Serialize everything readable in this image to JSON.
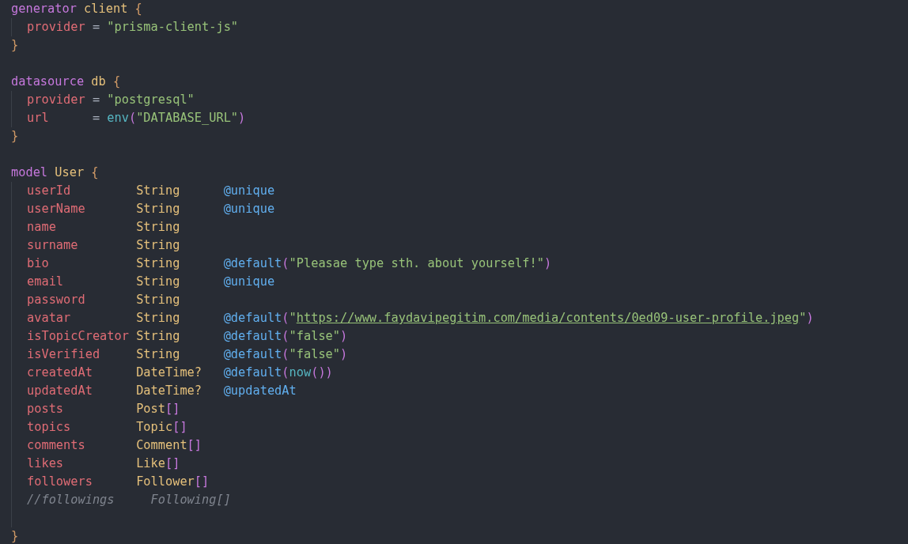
{
  "editor": {
    "blocks": [
      {
        "kind": "config",
        "head": [
          {
            "kind": "keyword",
            "text": "generator"
          },
          {
            "kind": "name",
            "text": "client"
          },
          {
            "kind": "brace",
            "text": "{"
          }
        ],
        "close": "}",
        "fields": [
          {
            "kind": "field",
            "cells": [
              [
                {
                  "kind": "property",
                  "text": "provider"
                }
              ],
              [
                {
                  "kind": "operator",
                  "text": "="
                }
              ],
              [
                {
                  "kind": "string",
                  "text": "\"prisma-client-js\""
                }
              ]
            ]
          }
        ]
      },
      {
        "kind": "config",
        "head": [
          {
            "kind": "keyword",
            "text": "datasource"
          },
          {
            "kind": "name",
            "text": "db"
          },
          {
            "kind": "brace",
            "text": "{"
          }
        ],
        "close": "}",
        "fields": [
          {
            "kind": "field",
            "cells": [
              [
                {
                  "kind": "property",
                  "text": "provider"
                }
              ],
              [
                {
                  "kind": "operator",
                  "text": "="
                }
              ],
              [
                {
                  "kind": "string",
                  "text": "\"postgresql\""
                }
              ]
            ]
          },
          {
            "kind": "field",
            "cells": [
              [
                {
                  "kind": "property",
                  "text": "url"
                }
              ],
              [
                {
                  "kind": "operator",
                  "text": "="
                }
              ],
              [
                {
                  "kind": "func",
                  "text": "env"
                },
                {
                  "kind": "paren",
                  "text": "("
                },
                {
                  "kind": "string",
                  "text": "\"DATABASE_URL\""
                },
                {
                  "kind": "paren",
                  "text": ")"
                }
              ]
            ]
          }
        ]
      },
      {
        "kind": "model",
        "head": [
          {
            "kind": "keyword",
            "text": "model"
          },
          {
            "kind": "name",
            "text": "User"
          },
          {
            "kind": "brace",
            "text": "{"
          }
        ],
        "close": "}",
        "fields": [
          {
            "kind": "field",
            "cells": [
              [
                {
                  "kind": "property",
                  "text": "userId"
                }
              ],
              [
                {
                  "kind": "type",
                  "text": "String"
                }
              ],
              [
                {
                  "kind": "attr",
                  "text": "@unique"
                }
              ]
            ]
          },
          {
            "kind": "field",
            "cells": [
              [
                {
                  "kind": "property",
                  "text": "userName"
                }
              ],
              [
                {
                  "kind": "type",
                  "text": "String"
                }
              ],
              [
                {
                  "kind": "attr",
                  "text": "@unique"
                }
              ]
            ]
          },
          {
            "kind": "field",
            "cells": [
              [
                {
                  "kind": "property",
                  "text": "name"
                }
              ],
              [
                {
                  "kind": "type",
                  "text": "String"
                }
              ],
              []
            ]
          },
          {
            "kind": "field",
            "cells": [
              [
                {
                  "kind": "property",
                  "text": "surname"
                }
              ],
              [
                {
                  "kind": "type",
                  "text": "String"
                }
              ],
              []
            ]
          },
          {
            "kind": "field",
            "cells": [
              [
                {
                  "kind": "property",
                  "text": "bio"
                }
              ],
              [
                {
                  "kind": "type",
                  "text": "String"
                }
              ],
              [
                {
                  "kind": "attr",
                  "text": "@default"
                },
                {
                  "kind": "paren",
                  "text": "("
                },
                {
                  "kind": "string",
                  "text": "\"Pleasae type sth. about yourself!\""
                },
                {
                  "kind": "paren",
                  "text": ")"
                }
              ]
            ]
          },
          {
            "kind": "field",
            "cells": [
              [
                {
                  "kind": "property",
                  "text": "email"
                }
              ],
              [
                {
                  "kind": "type",
                  "text": "String"
                }
              ],
              [
                {
                  "kind": "attr",
                  "text": "@unique"
                }
              ]
            ]
          },
          {
            "kind": "field",
            "cells": [
              [
                {
                  "kind": "property",
                  "text": "password"
                }
              ],
              [
                {
                  "kind": "type",
                  "text": "String"
                }
              ],
              []
            ]
          },
          {
            "kind": "field",
            "cells": [
              [
                {
                  "kind": "property",
                  "text": "avatar"
                }
              ],
              [
                {
                  "kind": "type",
                  "text": "String"
                }
              ],
              [
                {
                  "kind": "attr",
                  "text": "@default"
                },
                {
                  "kind": "paren",
                  "text": "("
                },
                {
                  "kind": "string",
                  "text": "\""
                },
                {
                  "kind": "link",
                  "text": "https://www.faydavipegitim.com/media/contents/0ed09-user-profile.jpeg"
                },
                {
                  "kind": "string",
                  "text": "\""
                },
                {
                  "kind": "paren",
                  "text": ")"
                }
              ]
            ]
          },
          {
            "kind": "field",
            "cells": [
              [
                {
                  "kind": "property",
                  "text": "isTopicCreator"
                }
              ],
              [
                {
                  "kind": "type",
                  "text": "String"
                }
              ],
              [
                {
                  "kind": "attr",
                  "text": "@default"
                },
                {
                  "kind": "paren",
                  "text": "("
                },
                {
                  "kind": "string",
                  "text": "\"false\""
                },
                {
                  "kind": "paren",
                  "text": ")"
                }
              ]
            ]
          },
          {
            "kind": "field",
            "cells": [
              [
                {
                  "kind": "property",
                  "text": "isVerified"
                }
              ],
              [
                {
                  "kind": "type",
                  "text": "String"
                }
              ],
              [
                {
                  "kind": "attr",
                  "text": "@default"
                },
                {
                  "kind": "paren",
                  "text": "("
                },
                {
                  "kind": "string",
                  "text": "\"false\""
                },
                {
                  "kind": "paren",
                  "text": ")"
                }
              ]
            ]
          },
          {
            "kind": "field",
            "cells": [
              [
                {
                  "kind": "property",
                  "text": "createdAt"
                }
              ],
              [
                {
                  "kind": "type",
                  "text": "DateTime?"
                }
              ],
              [
                {
                  "kind": "attr",
                  "text": "@default"
                },
                {
                  "kind": "paren",
                  "text": "("
                },
                {
                  "kind": "func",
                  "text": "now"
                },
                {
                  "kind": "paren",
                  "text": "())"
                }
              ]
            ]
          },
          {
            "kind": "field",
            "cells": [
              [
                {
                  "kind": "property",
                  "text": "updatedAt"
                }
              ],
              [
                {
                  "kind": "type",
                  "text": "DateTime?"
                }
              ],
              [
                {
                  "kind": "attr",
                  "text": "@updatedAt"
                }
              ]
            ]
          },
          {
            "kind": "field",
            "cells": [
              [
                {
                  "kind": "property",
                  "text": "posts"
                }
              ],
              [
                {
                  "kind": "type",
                  "text": "Post"
                },
                {
                  "kind": "paren",
                  "text": "[]"
                }
              ],
              []
            ]
          },
          {
            "kind": "field",
            "cells": [
              [
                {
                  "kind": "property",
                  "text": "topics"
                }
              ],
              [
                {
                  "kind": "type",
                  "text": "Topic"
                },
                {
                  "kind": "paren",
                  "text": "[]"
                }
              ],
              []
            ]
          },
          {
            "kind": "field",
            "cells": [
              [
                {
                  "kind": "property",
                  "text": "comments"
                }
              ],
              [
                {
                  "kind": "type",
                  "text": "Comment"
                },
                {
                  "kind": "paren",
                  "text": "[]"
                }
              ],
              []
            ]
          },
          {
            "kind": "field",
            "cells": [
              [
                {
                  "kind": "property",
                  "text": "likes"
                }
              ],
              [
                {
                  "kind": "type",
                  "text": "Like"
                },
                {
                  "kind": "paren",
                  "text": "[]"
                }
              ],
              []
            ]
          },
          {
            "kind": "field",
            "cells": [
              [
                {
                  "kind": "property",
                  "text": "followers"
                }
              ],
              [
                {
                  "kind": "type",
                  "text": "Follower"
                },
                {
                  "kind": "paren",
                  "text": "[]"
                }
              ],
              []
            ]
          },
          {
            "kind": "comment",
            "cells": [
              [
                {
                  "kind": "comment",
                  "text": "//followings     Following[]"
                }
              ]
            ]
          },
          {
            "kind": "blank"
          }
        ]
      }
    ]
  }
}
